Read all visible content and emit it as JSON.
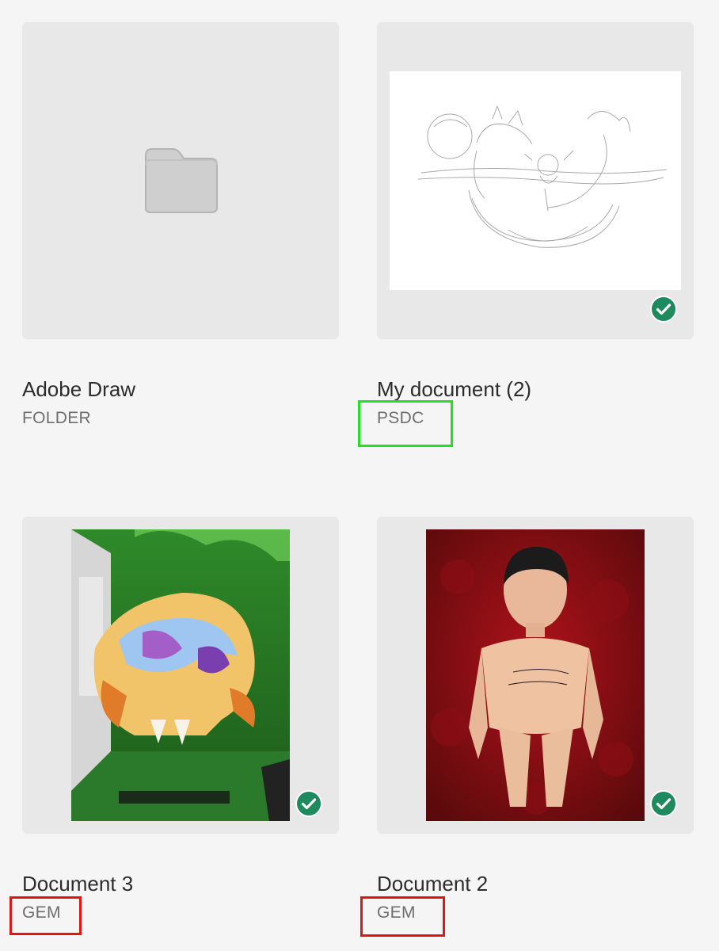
{
  "items": [
    {
      "title": "Adobe Draw",
      "type": "FOLDER",
      "thumbnail": "folder-icon",
      "synced": false
    },
    {
      "title": "My document (2)",
      "type": "PSDC",
      "thumbnail": "sketch",
      "synced": true
    },
    {
      "title": "Document 3",
      "type": "GEM",
      "thumbnail": "skull-artwork",
      "synced": true
    },
    {
      "title": "Document 2",
      "type": "GEM",
      "thumbnail": "wooden-figure-photo",
      "synced": true
    }
  ],
  "colors": {
    "background": "#f5f5f5",
    "card": "#e8e8e8",
    "synced_badge": "#1f8a5e",
    "highlight_green": "#22e022",
    "highlight_red": "#e01515"
  },
  "highlights": [
    {
      "target": "items.1.type",
      "color": "green"
    },
    {
      "target": "items.2.type",
      "color": "red"
    },
    {
      "target": "items.3.type",
      "color": "red"
    }
  ]
}
